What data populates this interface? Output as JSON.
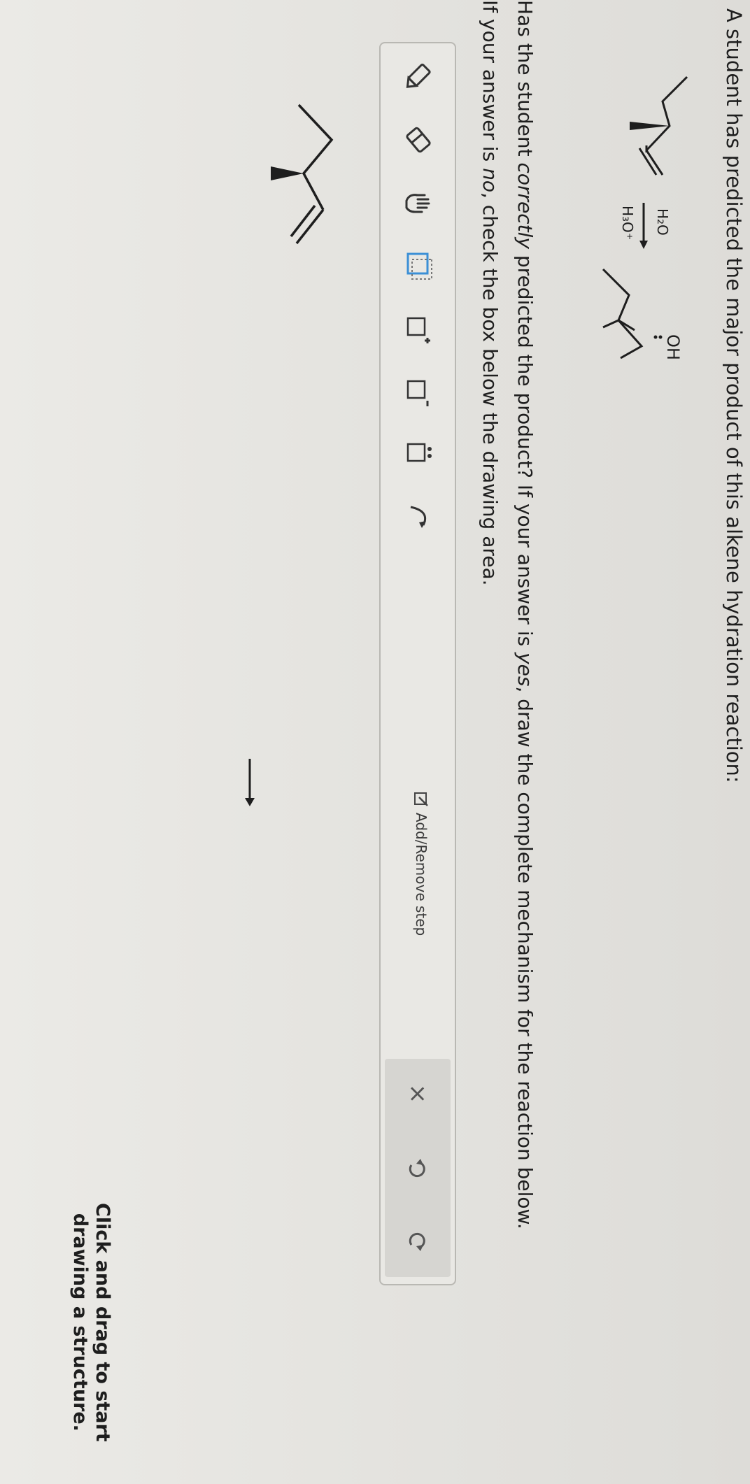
{
  "question": {
    "title": "A student has predicted the major product of this alkene hydration reaction:",
    "line1_parts": [
      "Has the student ",
      "correctly",
      " predicted the product? If your answer is ",
      "yes",
      ", draw the complete mechanism for the reaction below."
    ],
    "line2_parts": [
      "If your answer is ",
      "no",
      ", check the box below the drawing area."
    ]
  },
  "reaction": {
    "reagent_top": "H₂O",
    "reagent_bottom": "H₃O⁺",
    "product_group": "OH"
  },
  "toolbar": {
    "tools": [
      {
        "name": "pencil-tool",
        "icon": "pencil-icon"
      },
      {
        "name": "eraser-tool",
        "icon": "eraser-icon"
      },
      {
        "name": "hand-tool",
        "icon": "hand-icon"
      },
      {
        "name": "box-selection-tool",
        "icon": "box-select-icon"
      },
      {
        "name": "positive-charge-tool",
        "icon": "plus-charge-icon",
        "symbol": "+"
      },
      {
        "name": "negative-charge-tool",
        "icon": "minus-charge-icon",
        "symbol": "−"
      },
      {
        "name": "lone-pair-tool",
        "icon": "lone-pair-icon"
      },
      {
        "name": "curved-arrow-tool",
        "icon": "curved-arrow-icon"
      }
    ],
    "add_remove_label": "Add/Remove step",
    "controls": {
      "clear_icon": "close-icon",
      "undo_icon": "undo-icon",
      "redo_icon": "redo-icon",
      "clear_symbol": "×"
    }
  },
  "drawing_area": {
    "instruction_line1": "Click and drag to start",
    "instruction_line2": "drawing a structure."
  },
  "colors": {
    "background": "#e6e5e1",
    "panel": "#e9e8e4",
    "control_bar": "#d6d5d1",
    "text": "#1e1e1e"
  }
}
